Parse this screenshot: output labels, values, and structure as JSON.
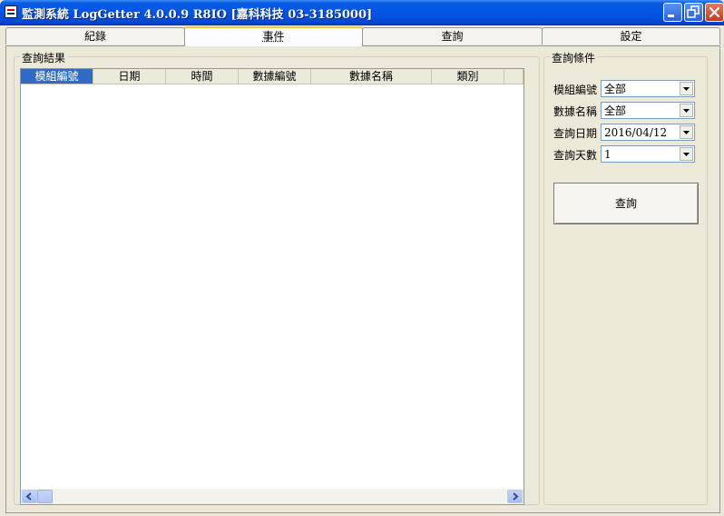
{
  "window": {
    "title": "監測系統 LogGetter 4.0.0.9 R8IO  [嘉科科技 03-3185000]"
  },
  "tabs": [
    {
      "label": "紀錄",
      "active": false
    },
    {
      "label": "事件",
      "active": true
    },
    {
      "label": "查詢",
      "active": false
    },
    {
      "label": "設定",
      "active": false
    }
  ],
  "results": {
    "group_title": "查詢結果",
    "columns": [
      "模組編號",
      "日期",
      "時間",
      "數據編號",
      "數據名稱",
      "類別"
    ],
    "selected_column": "模組編號",
    "rows": []
  },
  "conditions": {
    "group_title": "查詢條件",
    "fields": [
      {
        "label": "模組編號",
        "value": "全部"
      },
      {
        "label": "數據名稱",
        "value": "全部"
      },
      {
        "label": "查詢日期",
        "value": "2016/04/12"
      },
      {
        "label": "查詢天數",
        "value": "1"
      }
    ],
    "query_button": "查詢"
  },
  "colors": {
    "titlebar": "#0055e5",
    "tab_highlight": "#ffc83c",
    "selected_header": "#316ac5"
  },
  "icons": {
    "app": "app-monitor-icon",
    "minimize": "minimize-icon",
    "maximize": "restore-icon",
    "close": "close-icon",
    "scroll_left": "scroll-left-arrow-icon",
    "scroll_right": "scroll-right-arrow-icon",
    "dropdown": "chevron-down-icon"
  }
}
